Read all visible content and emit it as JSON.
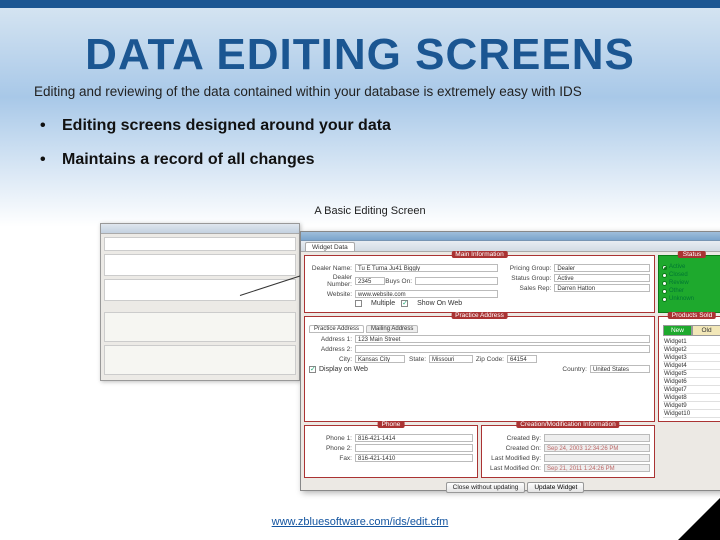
{
  "title": "DATA EDITING SCREENS",
  "subtitle": "Editing and reviewing of the data contained within your database is extremely easy with IDS",
  "bullets": [
    "Editing screens designed around your data",
    "Maintains a record of all changes"
  ],
  "screenshot_caption": "A Basic Editing Screen",
  "footer_link": "www.zbluesoftware.com/ids/edit.cfm",
  "main_tab": "Widget Data",
  "panels": {
    "main": "Main Information",
    "status": "Status",
    "address": "Practice Address",
    "phone": "Phone",
    "cm": "Creation/Modification Information",
    "sold": "Products Sold"
  },
  "status_options": [
    "Active",
    "Closed",
    "Review",
    "Other",
    "Unknown"
  ],
  "status_selected": 0,
  "fields": {
    "dealer_name_label": "Dealer Name:",
    "dealer_name": "Tu E Turna Ju41 Biggly",
    "dealer_number_label": "Dealer Number:",
    "dealer_number": "2345",
    "buys_on_label": "Buys On:",
    "buys_on": "",
    "website_label": "Website:",
    "website": "www.website.com",
    "multiple_label": "Multiple",
    "show_web_label": "Show On Web",
    "pricing_group_label": "Pricing Group:",
    "pricing_group": "Dealer",
    "status_group_label": "Status Group:",
    "status_group": "Active",
    "sales_rep_label": "Sales Rep:",
    "sales_rep": "Darren Hatton",
    "addr_tab1": "Practice Address",
    "addr_tab2": "Mailing Address",
    "addr1_label": "Address 1:",
    "addr1": "123 Main Street",
    "addr2_label": "Address 2:",
    "addr2": "",
    "city_label": "City:",
    "city": "Kansas City",
    "state_label": "State:",
    "state": "Missouri",
    "zip_label": "Zip Code:",
    "zip": "64154",
    "country_label": "Country:",
    "country": "United States",
    "display_web_label": "Display on Web",
    "phone1_label": "Phone 1:",
    "phone1": "816-421-1414",
    "phone2_label": "Phone 2:",
    "phone2": "",
    "fax_label": "Fax:",
    "fax": "816-421-1410",
    "created_by_label": "Created By:",
    "created_by": "",
    "created_on_label": "Created On:",
    "created_on": "Sep 24, 2003 12:34:26 PM",
    "modified_by_label": "Last Modified By:",
    "modified_by": "",
    "modified_on_label": "Last Modified On:",
    "modified_on": "Sep 21, 2011 1:24:26 PM"
  },
  "sold_new": "New",
  "sold_old": "Old",
  "sold_items": [
    "Widget1",
    "Widget2",
    "Widget3",
    "Widget4",
    "Widget5",
    "Widget6",
    "Widget7",
    "Widget8",
    "Widget9",
    "Widget10"
  ],
  "buttons": {
    "close": "Close without updating",
    "update": "Update Widget"
  }
}
